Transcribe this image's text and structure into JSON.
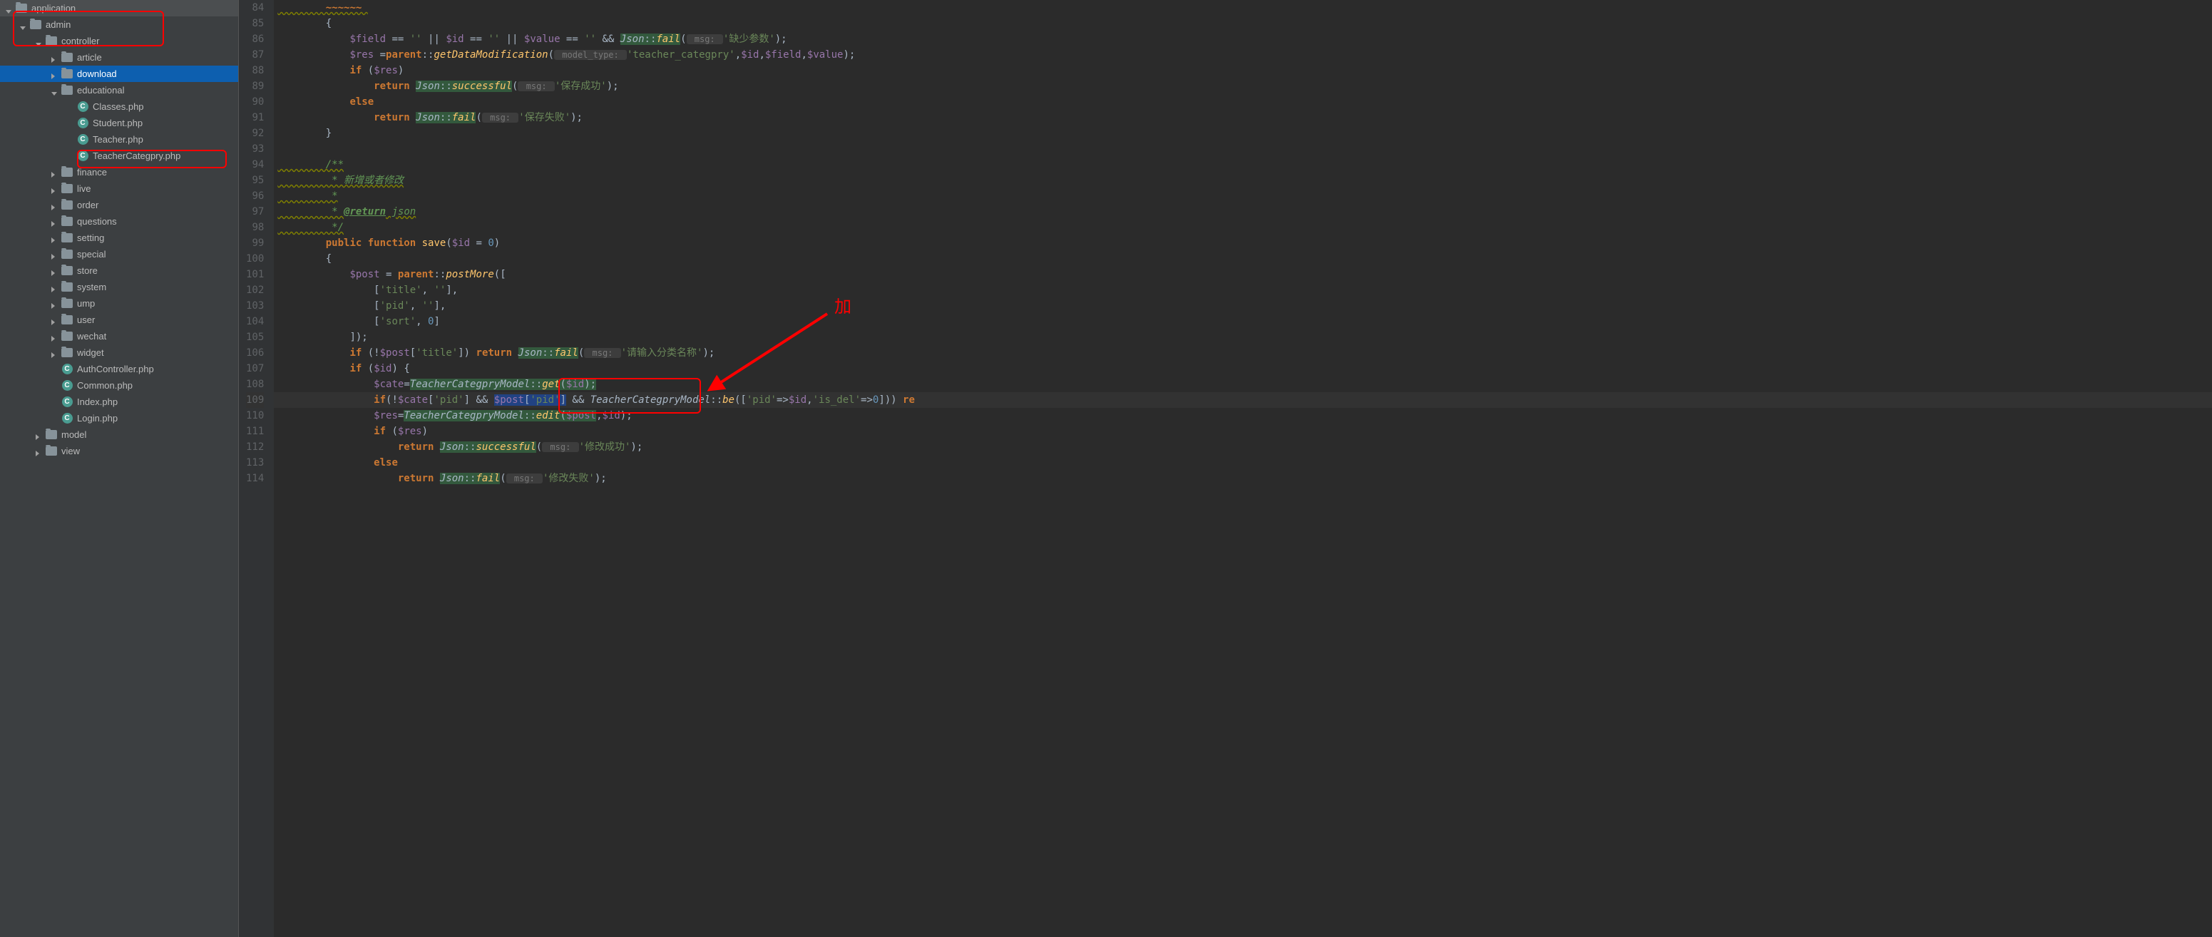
{
  "sidebar": {
    "items": [
      {
        "label": "application",
        "icon": "folder",
        "arrow": "down",
        "indent": 0
      },
      {
        "label": "admin",
        "icon": "folder",
        "arrow": "down",
        "indent": 1
      },
      {
        "label": "controller",
        "icon": "folder",
        "arrow": "down",
        "indent": 2
      },
      {
        "label": "article",
        "icon": "folder",
        "arrow": "right",
        "indent": 3
      },
      {
        "label": "download",
        "icon": "folder",
        "arrow": "right",
        "indent": 3,
        "selected": true
      },
      {
        "label": "educational",
        "icon": "folder",
        "arrow": "down",
        "indent": 3
      },
      {
        "label": "Classes.php",
        "icon": "class",
        "arrow": "none",
        "indent": 4
      },
      {
        "label": "Student.php",
        "icon": "class",
        "arrow": "none",
        "indent": 4
      },
      {
        "label": "Teacher.php",
        "icon": "class",
        "arrow": "none",
        "indent": 4
      },
      {
        "label": "TeacherCategpry.php",
        "icon": "class",
        "arrow": "none",
        "indent": 4
      },
      {
        "label": "finance",
        "icon": "folder",
        "arrow": "right",
        "indent": 3
      },
      {
        "label": "live",
        "icon": "folder",
        "arrow": "right",
        "indent": 3
      },
      {
        "label": "order",
        "icon": "folder",
        "arrow": "right",
        "indent": 3
      },
      {
        "label": "questions",
        "icon": "folder",
        "arrow": "right",
        "indent": 3
      },
      {
        "label": "setting",
        "icon": "folder",
        "arrow": "right",
        "indent": 3
      },
      {
        "label": "special",
        "icon": "folder",
        "arrow": "right",
        "indent": 3
      },
      {
        "label": "store",
        "icon": "folder",
        "arrow": "right",
        "indent": 3
      },
      {
        "label": "system",
        "icon": "folder",
        "arrow": "right",
        "indent": 3
      },
      {
        "label": "ump",
        "icon": "folder",
        "arrow": "right",
        "indent": 3
      },
      {
        "label": "user",
        "icon": "folder",
        "arrow": "right",
        "indent": 3
      },
      {
        "label": "wechat",
        "icon": "folder",
        "arrow": "right",
        "indent": 3
      },
      {
        "label": "widget",
        "icon": "folder",
        "arrow": "right",
        "indent": 3
      },
      {
        "label": "AuthController.php",
        "icon": "class",
        "arrow": "none",
        "indent": 3
      },
      {
        "label": "Common.php",
        "icon": "class",
        "arrow": "none",
        "indent": 3
      },
      {
        "label": "Index.php",
        "icon": "class",
        "arrow": "none",
        "indent": 3
      },
      {
        "label": "Login.php",
        "icon": "class",
        "arrow": "none",
        "indent": 3
      },
      {
        "label": "model",
        "icon": "folder",
        "arrow": "right",
        "indent": 2
      },
      {
        "label": "view",
        "icon": "folder",
        "arrow": "right",
        "indent": 2
      }
    ]
  },
  "gutter": {
    "start": 84,
    "end": 114,
    "active": 109
  },
  "code": {
    "l84": "",
    "l85": "        {",
    "l86_a": "            ",
    "l86_field": "$field",
    "l86_b": " == ",
    "l86_s1": "''",
    "l86_c": " || ",
    "l86_id": "$id",
    "l86_d": " == ",
    "l86_s2": "''",
    "l86_e": " || ",
    "l86_val": "$value",
    "l86_f": " == ",
    "l86_s3": "''",
    "l86_g": " && ",
    "l86_json": "Json",
    "l86_h": "::",
    "l86_fail": "fail",
    "l86_i": "(",
    "l86_hint": " msg: ",
    "l86_msg": "'缺少参数'",
    "l86_j": ");",
    "l87_a": "            ",
    "l87_res": "$res",
    "l87_b": " =",
    "l87_parent": "parent",
    "l87_c": "::",
    "l87_fn": "getDataModification",
    "l87_d": "(",
    "l87_hint": " model_type: ",
    "l87_s": "'teacher_categpry'",
    "l87_e": ",",
    "l87_id": "$id",
    "l87_f": ",",
    "l87_field": "$field",
    "l87_g": ",",
    "l87_value": "$value",
    "l87_h": ");",
    "l88_a": "            ",
    "l88_if": "if ",
    "l88_b": "(",
    "l88_res": "$res",
    "l88_c": ")",
    "l89_a": "                ",
    "l89_ret": "return ",
    "l89_json": "Json",
    "l89_b": "::",
    "l89_fn": "successful",
    "l89_c": "(",
    "l89_hint": " msg: ",
    "l89_s": "'保存成功'",
    "l89_d": ");",
    "l90_a": "            ",
    "l90_else": "else",
    "l91_a": "                ",
    "l91_ret": "return ",
    "l91_json": "Json",
    "l91_b": "::",
    "l91_fn": "fail",
    "l91_c": "(",
    "l91_hint": " msg: ",
    "l91_s": "'保存失败'",
    "l91_d": ");",
    "l92": "        }",
    "l93": "",
    "l94": "        /**",
    "l95": "         * 新增或者修改",
    "l96": "         *",
    "l97_a": "         * ",
    "l97_tag": "@return",
    "l97_b": " json",
    "l98": "         */",
    "l99_a": "        ",
    "l99_pub": "public function ",
    "l99_fn": "save",
    "l99_b": "(",
    "l99_id": "$id",
    "l99_c": " = ",
    "l99_n": "0",
    "l99_d": ")",
    "l100": "        {",
    "l101_a": "            ",
    "l101_post": "$post",
    "l101_b": " = ",
    "l101_parent": "parent",
    "l101_c": "::",
    "l101_fn": "postMore",
    "l101_d": "([",
    "l102_a": "                [",
    "l102_s1": "'title'",
    "l102_b": ", ",
    "l102_s2": "''",
    "l102_c": "],",
    "l103_a": "                [",
    "l103_s1": "'pid'",
    "l103_b": ", ",
    "l103_s2": "''",
    "l103_c": "],",
    "l104_a": "                [",
    "l104_s1": "'sort'",
    "l104_b": ", ",
    "l104_n": "0",
    "l104_c": "]",
    "l105": "            ]);",
    "l106_a": "            ",
    "l106_if": "if ",
    "l106_b": "(!",
    "l106_post": "$post",
    "l106_c": "[",
    "l106_s": "'title'",
    "l106_d": "]) ",
    "l106_ret": "return ",
    "l106_json": "Json",
    "l106_e": "::",
    "l106_fn": "fail",
    "l106_f": "(",
    "l106_hint": " msg: ",
    "l106_msg": "'请输入分类名称'",
    "l106_g": ");",
    "l107_a": "            ",
    "l107_if": "if ",
    "l107_b": "(",
    "l107_id": "$id",
    "l107_c": ") {",
    "l108_a": "                ",
    "l108_cate": "$cate",
    "l108_b": "=",
    "l108_model": "TeacherCategpryModel",
    "l108_c": "::",
    "l108_fn": "get",
    "l108_d": "(",
    "l108_id": "$id",
    "l108_e": ");",
    "l109_a": "                ",
    "l109_if": "if",
    "l109_b": "(!",
    "l109_cate": "$cate",
    "l109_c": "[",
    "l109_s1": "'pid'",
    "l109_d": "] && ",
    "l109_post": "$post",
    "l109_e": "[",
    "l109_s2": "'pid'",
    "l109_f": "]",
    "l109_g": " && ",
    "l109_model": "TeacherCategpryModel",
    "l109_h": "::",
    "l109_be": "be",
    "l109_i": "([",
    "l109_s3": "'pid'",
    "l109_j": "=>",
    "l109_id": "$id",
    "l109_k": ",",
    "l109_s4": "'is_del'",
    "l109_l": "=>",
    "l109_n": "0",
    "l109_m": "])) ",
    "l109_re": "re",
    "l110_a": "                ",
    "l110_res": "$res",
    "l110_b": "=",
    "l110_model": "TeacherCategpryModel",
    "l110_c": "::",
    "l110_fn": "edit",
    "l110_d": "(",
    "l110_post": "$post",
    "l110_e": ",",
    "l110_id": "$id",
    "l110_f": ");",
    "l111_a": "                ",
    "l111_if": "if ",
    "l111_b": "(",
    "l111_res": "$res",
    "l111_c": ")",
    "l112_a": "                    ",
    "l112_ret": "return ",
    "l112_json": "Json",
    "l112_b": "::",
    "l112_fn": "successful",
    "l112_c": "(",
    "l112_hint": " msg: ",
    "l112_s": "'修改成功'",
    "l112_d": ");",
    "l113_a": "                ",
    "l113_else": "else",
    "l114_a": "                    ",
    "l114_ret": "return ",
    "l114_json": "Json",
    "l114_b": "::",
    "l114_fn": "fail",
    "l114_c": "(",
    "l114_hint": " msg: ",
    "l114_s": "'修改失败'",
    "l114_d": ");"
  },
  "annotations": {
    "add_label": "加"
  }
}
